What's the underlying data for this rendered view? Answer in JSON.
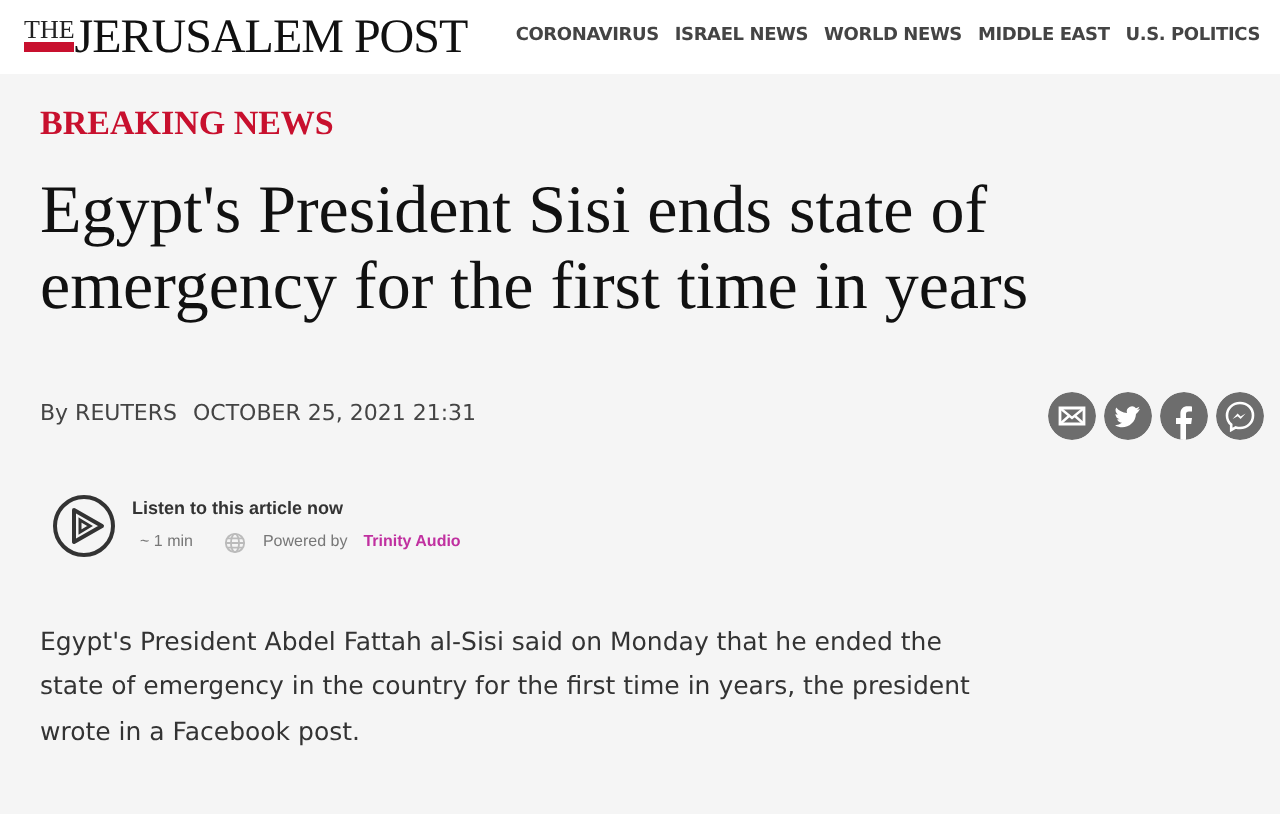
{
  "header": {
    "logo": {
      "small": "THE",
      "main": "JERUSALEM POST"
    },
    "nav": [
      "CORONAVIRUS",
      "ISRAEL NEWS",
      "WORLD NEWS",
      "MIDDLE EAST",
      "U.S. POLITICS"
    ]
  },
  "article": {
    "kicker": "BREAKING NEWS",
    "headline": "Egypt's President Sisi ends state of emergency for the first time in years",
    "byline": "By REUTERS",
    "date": "OCTOBER 25, 2021 21:31",
    "share": [
      {
        "kind": "email"
      },
      {
        "kind": "twitter"
      },
      {
        "kind": "facebook"
      },
      {
        "kind": "messenger"
      }
    ],
    "audio": {
      "title": "Listen to this article now",
      "duration": "~ 1 min",
      "powered": "Powered by",
      "brand": "Trinity Audio"
    },
    "body": "Egypt's President Abdel Fattah al-Sisi said on Monday that he ended the state of emergency in the country for the first time in years, the president wrote in a Facebook post."
  }
}
